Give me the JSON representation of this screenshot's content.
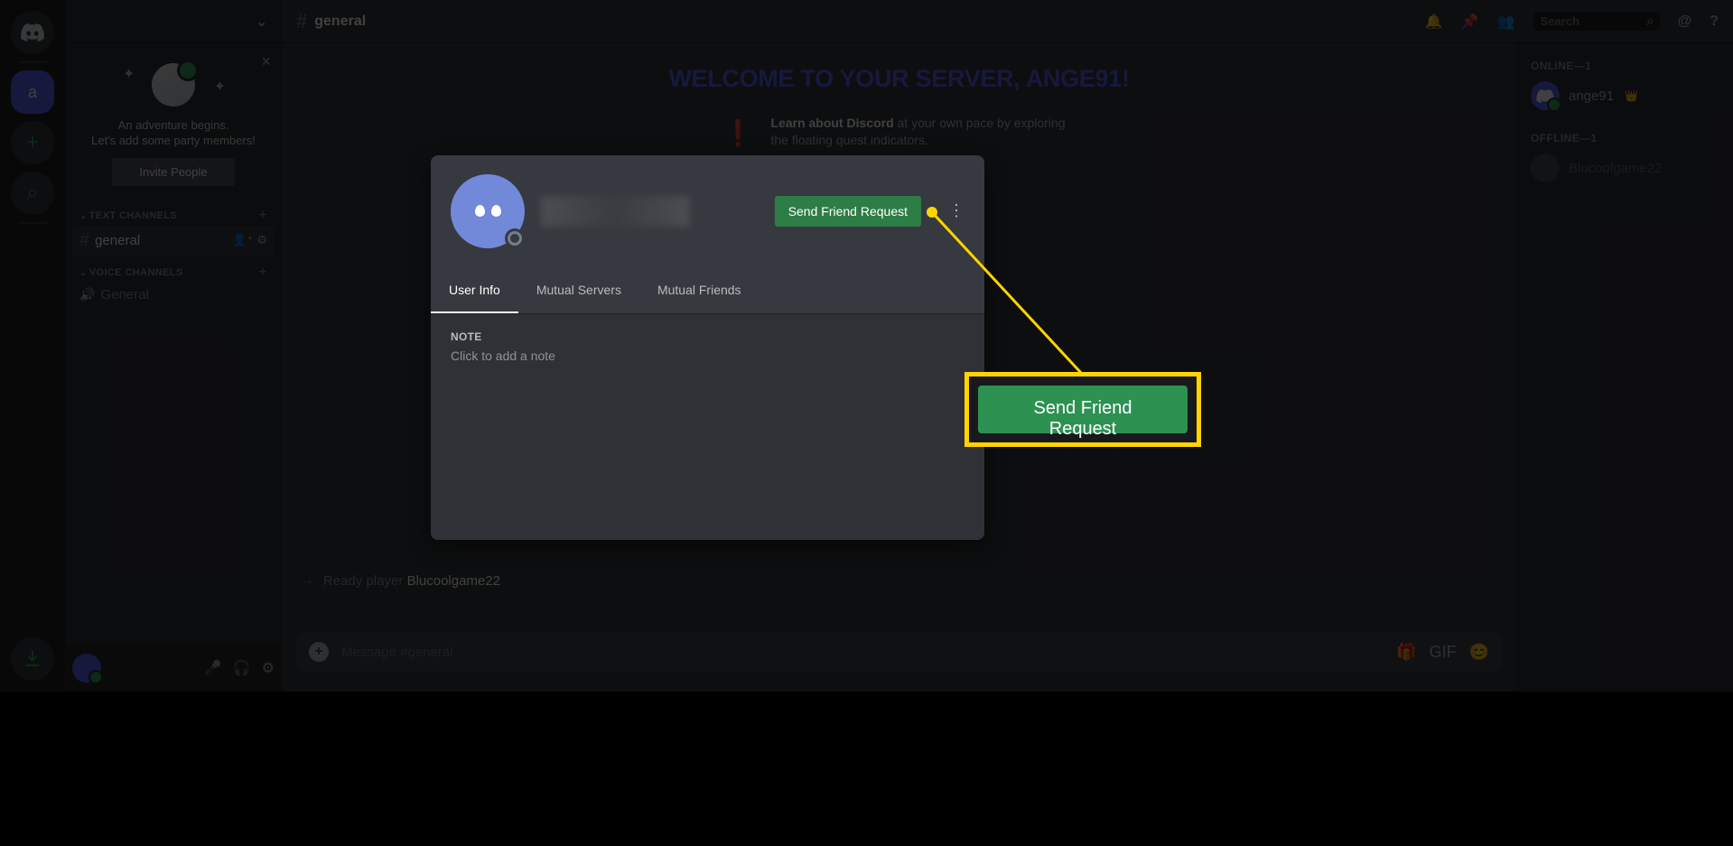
{
  "server_rail": {
    "active_initial": "a"
  },
  "channel_sidebar": {
    "server_name": "",
    "welcome": {
      "line1": "An adventure begins.",
      "line2": "Let's add some party members!",
      "invite_button": "Invite People"
    },
    "text_channels_header": "TEXT CHANNELS",
    "voice_channels_header": "VOICE CHANNELS",
    "text_channel": "general",
    "voice_channel": "General"
  },
  "main_header": {
    "channel_name": "general",
    "search_placeholder": "Search"
  },
  "main": {
    "welcome_title": "WELCOME TO YOUR SERVER, ANGE91!",
    "learn_bold": "Learn about Discord",
    "learn_text": " at your own pace by exploring the floating quest indicators.",
    "system_msg_prefix": "Ready player ",
    "system_msg_user": "Blucoolgame22",
    "system_msg_time": "",
    "input_placeholder": "Message #general"
  },
  "members": {
    "online_header": "ONLINE—1",
    "offline_header": "OFFLINE—1",
    "online_user": "ange91",
    "offline_user": "Blucoolgame22"
  },
  "profile_modal": {
    "send_button": "Send Friend Request",
    "tabs": {
      "user_info": "User Info",
      "mutual_servers": "Mutual Servers",
      "mutual_friends": "Mutual Friends"
    },
    "note_label": "NOTE",
    "note_placeholder": "Click to add a note"
  },
  "callout": {
    "button_text": "Send Friend Request"
  }
}
